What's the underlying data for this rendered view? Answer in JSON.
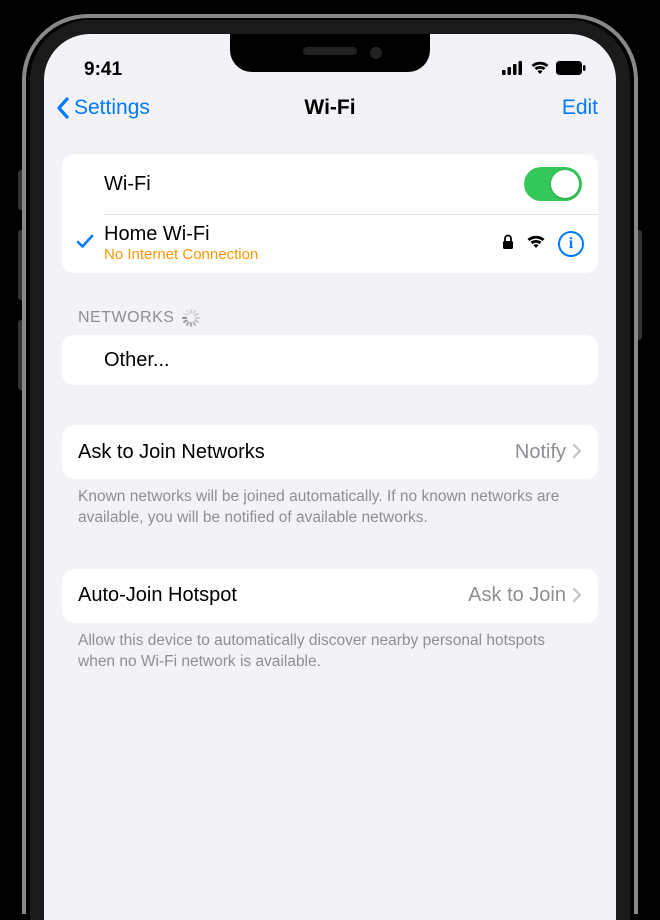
{
  "status_bar": {
    "time": "9:41"
  },
  "nav": {
    "back_label": "Settings",
    "title": "Wi-Fi",
    "edit_label": "Edit"
  },
  "wifi": {
    "toggle_label": "Wi-Fi",
    "toggle_on": true,
    "connected": {
      "name": "Home Wi-Fi",
      "status": "No Internet Connection"
    }
  },
  "networks": {
    "header": "NETWORKS",
    "other_label": "Other..."
  },
  "ask_to_join": {
    "label": "Ask to Join Networks",
    "value": "Notify",
    "footer": "Known networks will be joined automatically. If no known networks are available, you will be notified of available networks."
  },
  "auto_join": {
    "label": "Auto-Join Hotspot",
    "value": "Ask to Join",
    "footer": "Allow this device to automatically discover nearby personal hotspots when no Wi-Fi network is available."
  }
}
